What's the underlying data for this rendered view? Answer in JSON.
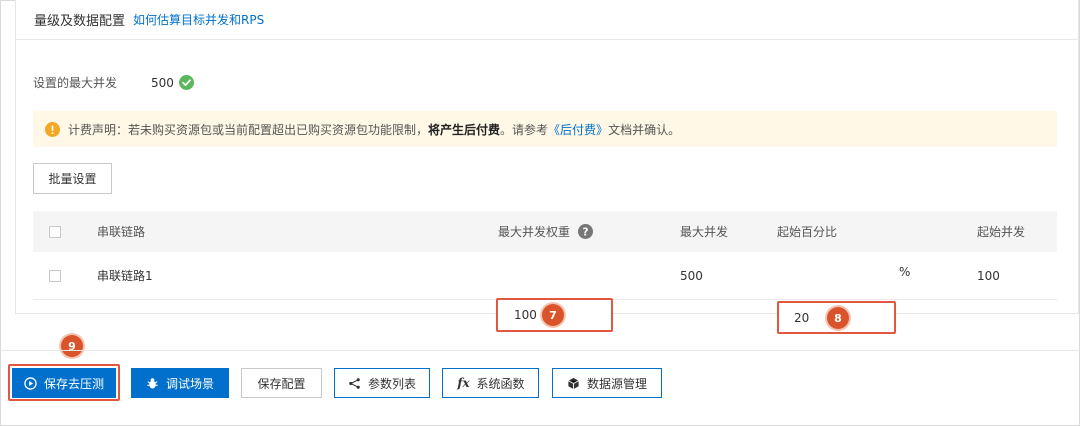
{
  "panel": {
    "title": "量级及数据配置",
    "help_link": "如何估算目标并发和RPS"
  },
  "max_concurrency": {
    "label": "设置的最大并发",
    "value": "500",
    "status_icon": "check-circle-icon"
  },
  "notice": {
    "prefix": "计费声明：若未购买资源包或当前配置超出已购买资源包功能限制，",
    "bold": "将产生后付费",
    "middle": "。请参考",
    "link": "《后付费》",
    "suffix": "文档并确认。",
    "icon": "info-warning-icon"
  },
  "batch_button": "批量设置",
  "table": {
    "headers": {
      "chain": "串联链路",
      "weight": "最大并发权重",
      "max": "最大并发",
      "start_percent": "起始百分比",
      "start_concurrency": "起始并发"
    },
    "rows": [
      {
        "chain": "串联链路1",
        "weight": "100",
        "max": "500",
        "start_percent": "20",
        "percent_unit": "%",
        "start_concurrency": "100"
      }
    ]
  },
  "badges": {
    "b7": "7",
    "b8": "8",
    "b9": "9"
  },
  "footer": {
    "save_and_test": "保存去压测",
    "debug_scene": "调试场景",
    "save_config": "保存配置",
    "param_list": "参数列表",
    "system_functions": "系统函数",
    "datasource_manage": "数据源管理"
  },
  "colors": {
    "primary": "#0070cc",
    "highlight": "#e2583e",
    "badge": "#d9542b",
    "success": "#5cb85c",
    "warning_bg": "#fff8e6",
    "warning_icon": "#f5a623"
  }
}
